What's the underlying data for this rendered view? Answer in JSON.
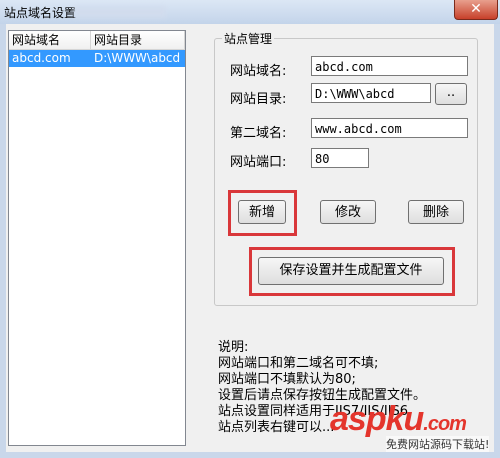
{
  "window": {
    "title": "站点域名设置",
    "close_label": "✕"
  },
  "site_list": {
    "columns": [
      "网站域名",
      "网站目录"
    ],
    "rows": [
      {
        "domain": "abcd.com",
        "directory": "D:\\WWW\\abcd"
      }
    ]
  },
  "site_manage": {
    "group_title": "站点管理",
    "domain_label": "网站域名:",
    "domain_value": "abcd.com",
    "dir_label": "网站目录:",
    "dir_value": "D:\\WWW\\abcd",
    "browse_label": "..",
    "second_label": "第二域名:",
    "second_value": "www.abcd.com",
    "port_label": "网站端口:",
    "port_value": "80",
    "add_label": "新增",
    "edit_label": "修改",
    "delete_label": "删除",
    "save_label": "保存设置并生成配置文件"
  },
  "notes": {
    "heading": "说明:",
    "lines": [
      "网站端口和第二域名可不填;",
      "网站端口不填默认为80;",
      "设置后请点保存按钮生成配置文件。",
      "站点设置同样适用于IIS7/IIS/IIS6,",
      "站点列表右键可以..."
    ]
  },
  "watermark": {
    "brand": "aspku",
    "suffix": ".com",
    "tagline": "免费网站源码下载站!"
  },
  "colors": {
    "highlight": "#d9373a",
    "selection": "#3399ff"
  }
}
